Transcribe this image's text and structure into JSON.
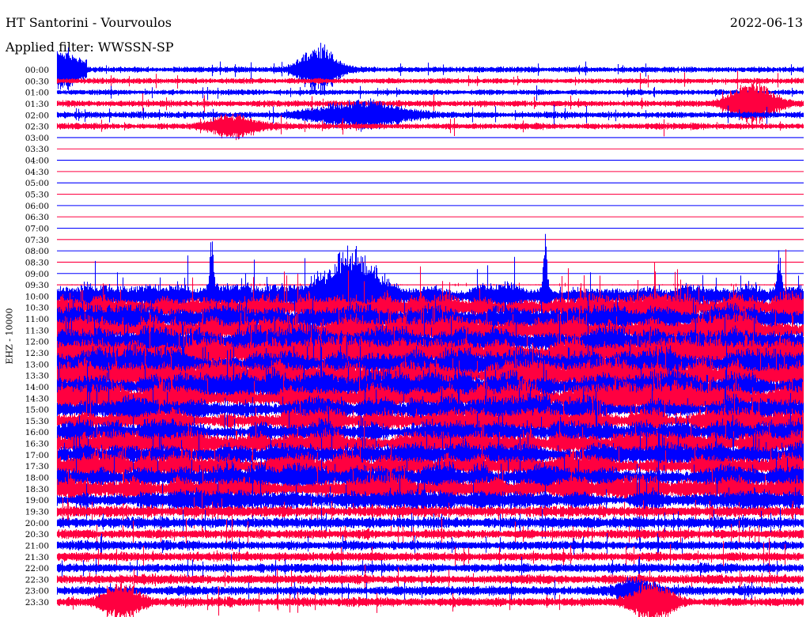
{
  "header": {
    "title": "HT Santorini - Vourvoulos",
    "filter": "Applied filter: WWSSN-SP",
    "date": "2022-06-13"
  },
  "chart_data": {
    "type": "line",
    "title": "HT Santorini - Vourvoulos",
    "subtitle": "Applied filter: WWSSN-SP",
    "date": "2022-06-13",
    "ylabel": "EHZ - 10000",
    "row_minutes": 30,
    "colors": [
      "#0000ff",
      "#ff0040"
    ],
    "rows": [
      {
        "label": "00:00",
        "noise": 3
      },
      {
        "label": "00:30",
        "noise": 3
      },
      {
        "label": "01:00",
        "noise": 3
      },
      {
        "label": "01:30",
        "noise": 3.5
      },
      {
        "label": "02:00",
        "noise": 3.5
      },
      {
        "label": "02:30",
        "noise": 3.5
      },
      {
        "label": "03:00",
        "noise": null
      },
      {
        "label": "03:30",
        "noise": null
      },
      {
        "label": "04:00",
        "noise": null
      },
      {
        "label": "04:30",
        "noise": null
      },
      {
        "label": "05:00",
        "noise": null
      },
      {
        "label": "05:30",
        "noise": null
      },
      {
        "label": "06:00",
        "noise": null
      },
      {
        "label": "06:30",
        "noise": null
      },
      {
        "label": "07:00",
        "noise": null
      },
      {
        "label": "07:30",
        "noise": null
      },
      {
        "label": "08:00",
        "noise": null
      },
      {
        "label": "08:30",
        "noise": null
      },
      {
        "label": "09:00",
        "noise": null
      },
      {
        "label": "09:30",
        "noise": 0.6
      },
      {
        "label": "10:00",
        "noise": 10
      },
      {
        "label": "10:30",
        "noise": 11
      },
      {
        "label": "11:00",
        "noise": 12
      },
      {
        "label": "11:30",
        "noise": 12
      },
      {
        "label": "12:00",
        "noise": 13
      },
      {
        "label": "12:30",
        "noise": 13
      },
      {
        "label": "13:00",
        "noise": 13
      },
      {
        "label": "13:30",
        "noise": 13
      },
      {
        "label": "14:00",
        "noise": 13
      },
      {
        "label": "14:30",
        "noise": 12
      },
      {
        "label": "15:00",
        "noise": 11
      },
      {
        "label": "15:30",
        "noise": 10
      },
      {
        "label": "16:00",
        "noise": 10
      },
      {
        "label": "16:30",
        "noise": 10
      },
      {
        "label": "17:00",
        "noise": 10
      },
      {
        "label": "17:30",
        "noise": 11
      },
      {
        "label": "18:00",
        "noise": 11
      },
      {
        "label": "18:30",
        "noise": 10
      },
      {
        "label": "19:00",
        "noise": 8
      },
      {
        "label": "19:30",
        "noise": 6
      },
      {
        "label": "20:00",
        "noise": 6
      },
      {
        "label": "20:30",
        "noise": 5
      },
      {
        "label": "21:00",
        "noise": 5
      },
      {
        "label": "21:30",
        "noise": 5
      },
      {
        "label": "22:00",
        "noise": 5
      },
      {
        "label": "22:30",
        "noise": 5
      },
      {
        "label": "23:00",
        "noise": 5
      },
      {
        "label": "23:30",
        "noise": 5
      }
    ],
    "events": [
      {
        "row": 0,
        "minute": 0.2,
        "amp": 14,
        "dur": 0.6
      },
      {
        "row": 0,
        "minute": 10.5,
        "amp": 30,
        "dur": 0.8
      },
      {
        "row": 3,
        "minute": 27.9,
        "amp": 24,
        "dur": 1.0
      },
      {
        "row": 4,
        "minute": 12.2,
        "amp": 16,
        "dur": 2.0
      },
      {
        "row": 5,
        "minute": 7.1,
        "amp": 14,
        "dur": 1.0
      },
      {
        "row": 20,
        "minute": 6.2,
        "amp": 70,
        "dur": 0.1
      },
      {
        "row": 20,
        "minute": 19.6,
        "amp": 80,
        "dur": 0.1
      },
      {
        "row": 20,
        "minute": 11.8,
        "amp": 45,
        "dur": 1.2
      },
      {
        "row": 20,
        "minute": 29.0,
        "amp": 60,
        "dur": 0.1
      },
      {
        "row": 46,
        "minute": 23.3,
        "amp": 15,
        "dur": 0.8
      },
      {
        "row": 47,
        "minute": 2.6,
        "amp": 20,
        "dur": 0.8
      },
      {
        "row": 47,
        "minute": 23.9,
        "amp": 22,
        "dur": 0.9
      }
    ]
  }
}
